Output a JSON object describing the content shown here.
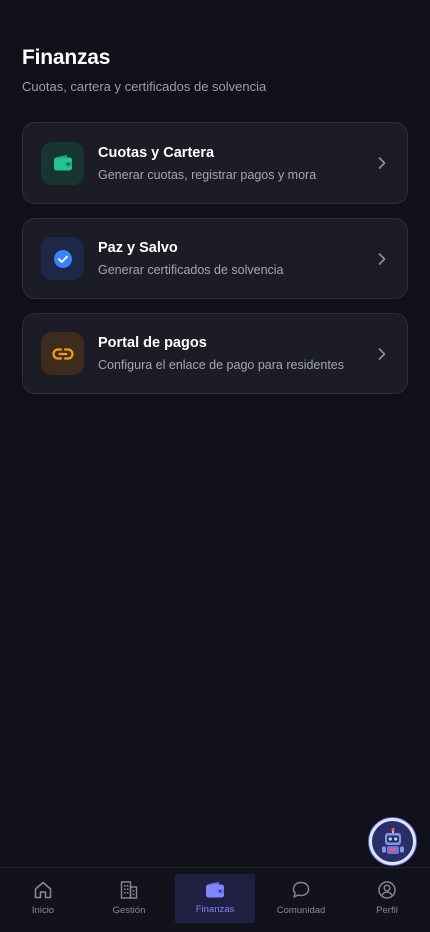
{
  "header": {
    "title": "Finanzas",
    "subtitle": "Cuotas, cartera y certificados de solvencia"
  },
  "cards": [
    {
      "title": "Cuotas y Cartera",
      "description": "Generar cuotas, registrar pagos y mora",
      "icon": "wallet-icon",
      "color": "#22c58b"
    },
    {
      "title": "Paz y Salvo",
      "description": "Generar certificados de solvencia",
      "icon": "check-circle-icon",
      "color": "#3b82f6"
    },
    {
      "title": "Portal de pagos",
      "description": "Configura el enlace de pago para residentes",
      "icon": "link-icon",
      "color": "#f59e0b"
    }
  ],
  "tabbar": {
    "items": [
      {
        "label": "Inicio",
        "icon": "home-icon"
      },
      {
        "label": "Gestión",
        "icon": "building-icon"
      },
      {
        "label": "Finanzas",
        "icon": "wallet-icon",
        "active": true
      },
      {
        "label": "Comunidad",
        "icon": "chat-icon"
      },
      {
        "label": "Perfil",
        "icon": "user-circle-icon"
      }
    ]
  },
  "colors": {
    "background": "#10101a",
    "card": "#1b1c26",
    "accent": "#7f86ff"
  }
}
